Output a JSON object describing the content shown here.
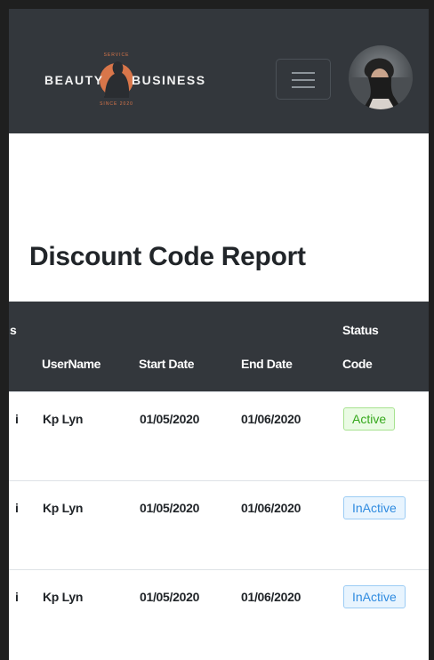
{
  "brand": {
    "word_left": "BEAUTY",
    "word_right": "BUSINESS",
    "tag_top": "SERVICE",
    "tag_bottom": "SINCE 2020"
  },
  "page": {
    "title": "Discount Code Report"
  },
  "table": {
    "header_partial": "s",
    "columns": {
      "username": "UserName",
      "start_date": "Start Date",
      "end_date": "End Date",
      "status_line1": "Status",
      "status_line2": "Code"
    },
    "rows": [
      {
        "partial": "i",
        "username": "Kp Lyn",
        "start_date": "01/05/2020",
        "end_date": "01/06/2020",
        "status": "Active"
      },
      {
        "partial": "i",
        "username": "Kp Lyn",
        "start_date": "01/05/2020",
        "end_date": "01/06/2020",
        "status": "InActive"
      },
      {
        "partial": "i",
        "username": "Kp Lyn",
        "start_date": "01/05/2020",
        "end_date": "01/06/2020",
        "status": "InActive"
      }
    ]
  },
  "colors": {
    "navbar": "#33373c",
    "active": "#35a81c",
    "inactive": "#2f8be0",
    "brand_accent": "#d9764a"
  },
  "icons": {
    "menu": "hamburger-icon",
    "avatar": "user-avatar"
  }
}
